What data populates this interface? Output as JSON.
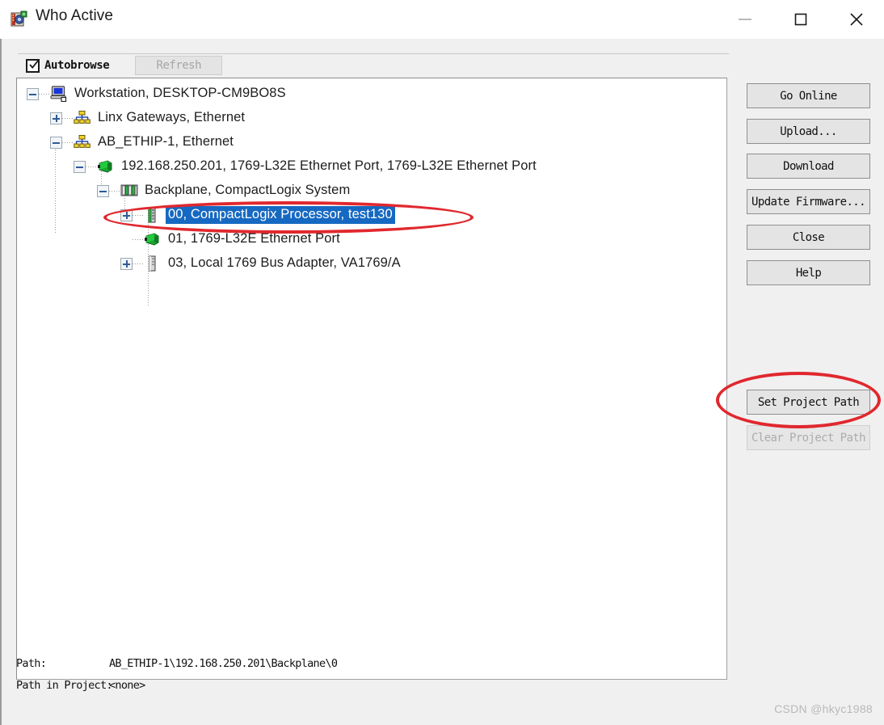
{
  "window": {
    "title": "Who Active",
    "app_icon": "rslinx-who-active-icon",
    "controls": {
      "minimize": "minimize-icon",
      "maximize": "maximize-icon",
      "close": "close-icon"
    }
  },
  "toolbar": {
    "autobrowse_label": "Autobrowse",
    "autobrowse_checked": true,
    "refresh_label": "Refresh",
    "refresh_enabled": false
  },
  "tree": {
    "nodes": [
      {
        "label": "Workstation, DESKTOP-CM9BO8S",
        "depth": 0,
        "expander": "minus",
        "icon": "workstation-computer-icon",
        "selected": false
      },
      {
        "label": "Linx Gateways, Ethernet",
        "depth": 1,
        "expander": "plus",
        "icon": "network-hub-yellow-icon",
        "selected": false
      },
      {
        "label": "AB_ETHIP-1, Ethernet",
        "depth": 1,
        "expander": "minus",
        "icon": "network-hub-blue-icon",
        "selected": false
      },
      {
        "label": "192.168.250.201, 1769-L32E Ethernet Port, 1769-L32E Ethernet Port",
        "depth": 2,
        "expander": "minus",
        "icon": "ethernet-port-green-icon",
        "selected": false
      },
      {
        "label": "Backplane, CompactLogix System",
        "depth": 3,
        "expander": "minus",
        "icon": "backplane-chassis-icon",
        "selected": false
      },
      {
        "label": "00, CompactLogix Processor, test130",
        "depth": 4,
        "expander": "plus",
        "icon": "processor-module-icon",
        "selected": true
      },
      {
        "label": "01, 1769-L32E Ethernet Port",
        "depth": 4,
        "expander": "none",
        "icon": "ethernet-port-green-icon",
        "selected": false
      },
      {
        "label": "03, Local 1769 Bus Adapter, VA1769/A",
        "depth": 4,
        "expander": "plus",
        "icon": "bus-adapter-module-icon",
        "selected": false
      }
    ]
  },
  "buttons": {
    "go_online": "Go Online",
    "upload": "Upload...",
    "download": "Download",
    "update_firmware": "Update Firmware...",
    "close": "Close",
    "help": "Help",
    "set_project_path": "Set Project Path",
    "clear_project_path": "Clear Project Path",
    "clear_project_path_enabled": false
  },
  "footer": {
    "path_label": "Path:",
    "path_value": "AB_ETHIP-1\\192.168.250.201\\Backplane\\0",
    "path_in_project_label": "Path in Project:",
    "path_in_project_value": "<none>"
  },
  "annotations": {
    "highlight_selected_node": "red-ellipse-around-selected-processor",
    "highlight_set_project_path": "red-ellipse-around-set-project-path-button",
    "color": "#e0282e"
  },
  "watermark": "CSDN @hkyc1988"
}
